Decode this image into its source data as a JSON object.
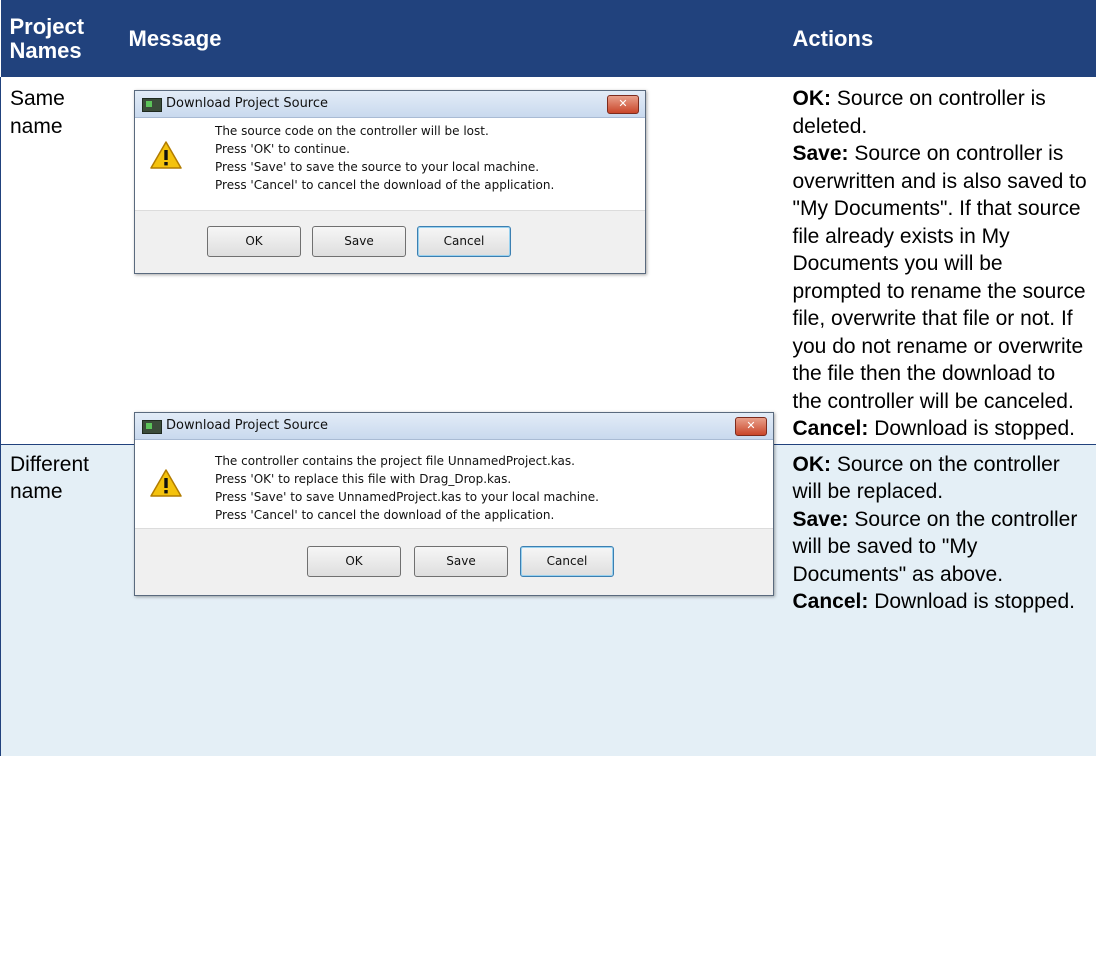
{
  "table": {
    "headers": {
      "project_names_line1": "Project",
      "project_names_line2": "Names",
      "message": "Message",
      "actions": "Actions"
    },
    "rows": [
      {
        "name_line1": "Same",
        "name_line2": "name",
        "dialog": {
          "title": "Download Project Source",
          "close_glyph": "✕",
          "icon": "warning-triangle-icon",
          "lines": [
            "The source code on the controller will be lost.",
            "Press 'OK' to continue.",
            "Press 'Save' to save the source to your local machine.",
            "Press 'Cancel' to cancel the download of the application."
          ],
          "buttons": [
            "OK",
            "Save",
            "Cancel"
          ]
        },
        "actions": {
          "ok_label": "OK:",
          "ok_text": " Source on controller is deleted.",
          "save_label": "Save:",
          "save_text": " Source on controller is overwritten and is also saved to \"My Documents\". If that source file already exists in My Documents you will be prompted to rename the source file, overwrite that file or not. If you do not rename or overwrite the file then the download to the controller will be canceled.",
          "cancel_label": "Cancel:",
          "cancel_text": " Download is stopped."
        }
      },
      {
        "name_line1": "Different",
        "name_line2": "name",
        "dialog": {
          "title": "Download Project Source",
          "close_glyph": "✕",
          "icon": "warning-triangle-icon",
          "lines": [
            "The controller contains the project file UnnamedProject.kas.",
            "Press 'OK' to replace this file with Drag_Drop.kas.",
            "Press 'Save' to save UnnamedProject.kas to your local machine.",
            "Press 'Cancel' to cancel the download of the application."
          ],
          "buttons": [
            "OK",
            "Save",
            "Cancel"
          ]
        },
        "actions": {
          "ok_label": "OK:",
          "ok_text": " Source on the controller will be replaced.",
          "save_label": "Save:",
          "save_text": " Source on the controller will be saved to \"My Documents\" as above.",
          "cancel_label": "Cancel:",
          "cancel_text": " Download is stopped."
        }
      }
    ]
  },
  "colors": {
    "header_bg": "#21427d",
    "row_alt_bg": "#e4eff6",
    "close_button": "#c9462a"
  }
}
